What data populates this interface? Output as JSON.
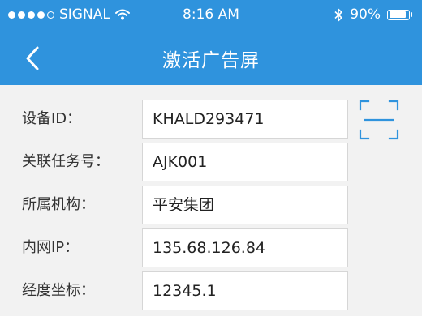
{
  "status_bar": {
    "carrier": "SIGNAL",
    "time": "8:16 AM",
    "battery_percent": "90%",
    "battery_level": 0.9,
    "signal_dots_filled": 4,
    "signal_dots_total": 5
  },
  "nav": {
    "title": "激活广告屏",
    "back_icon": "chevron-left-icon",
    "background_color": "#2f93dd"
  },
  "form": {
    "fields": [
      {
        "label": "设备ID：",
        "value": "KHALD293471"
      },
      {
        "label": "关联任务号：",
        "value": "AJK001"
      },
      {
        "label": "所属机构：",
        "value": "平安集团"
      },
      {
        "label": "内网IP：",
        "value": "135.68.126.84"
      },
      {
        "label": "经度坐标：",
        "value": "12345.1"
      }
    ],
    "scan_icon": "scan-icon",
    "accent_color": "#2f93dd"
  }
}
